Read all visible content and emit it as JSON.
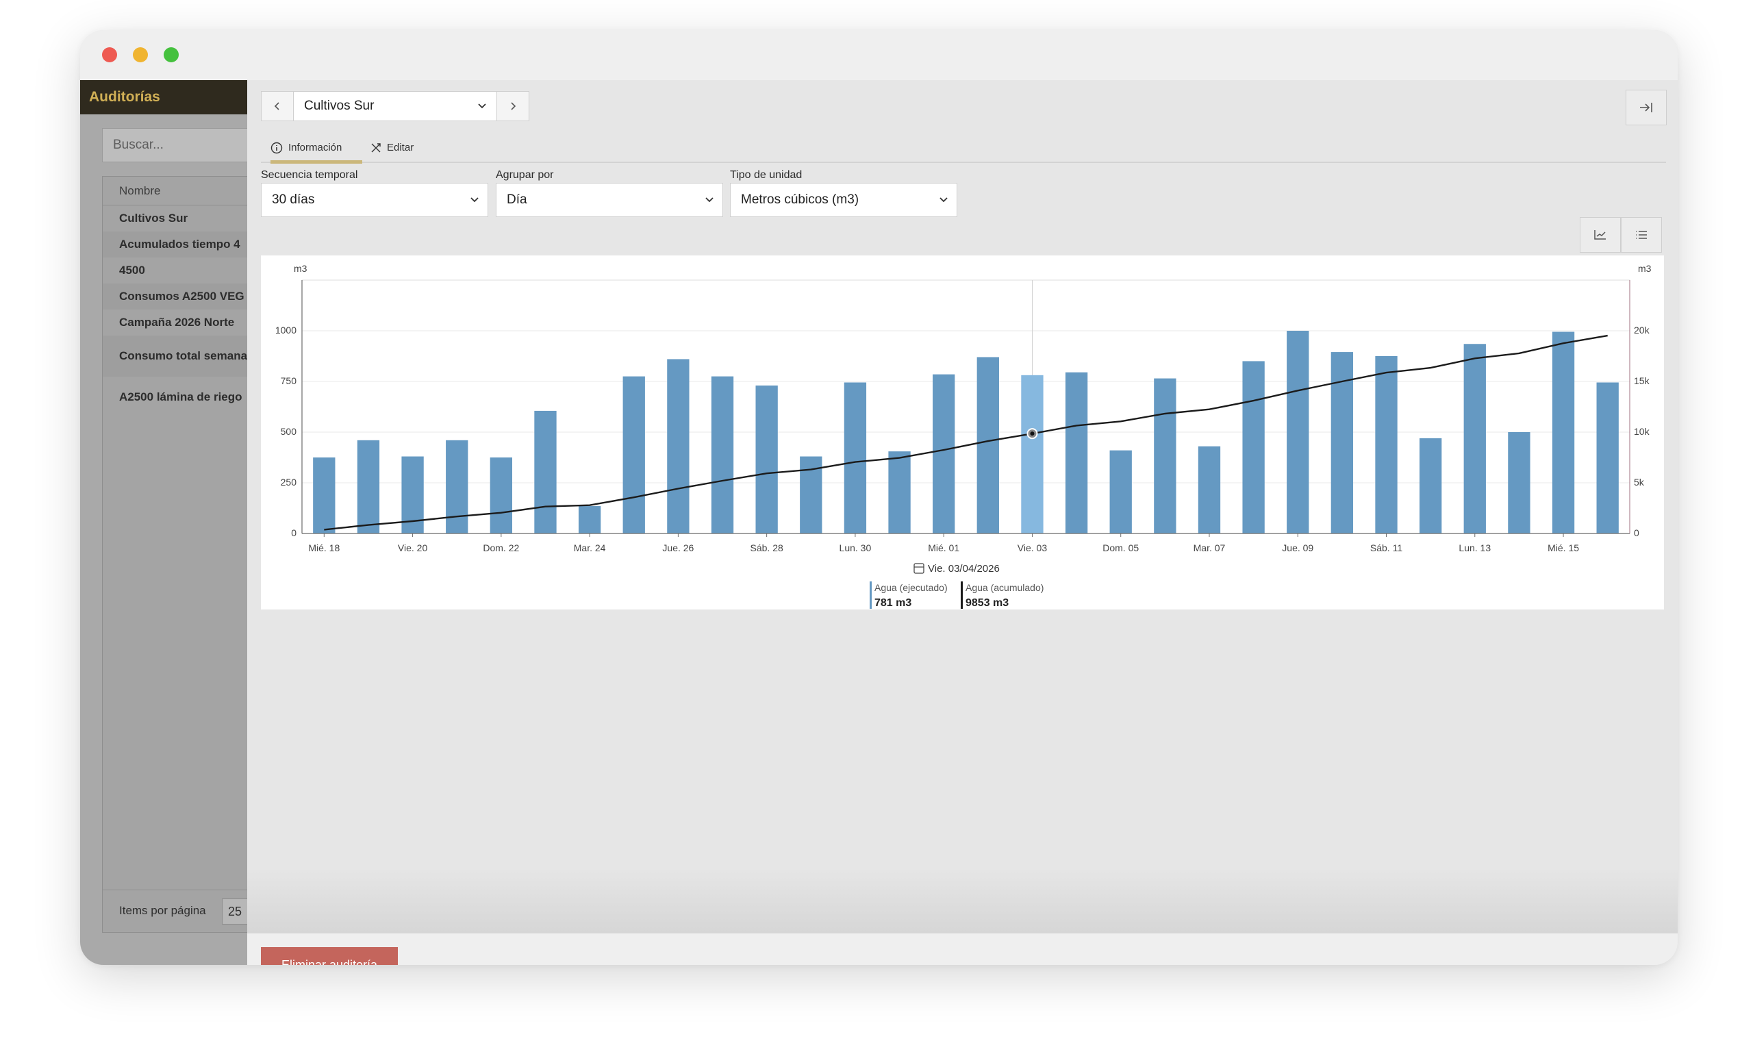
{
  "sidebar": {
    "title": "Auditorías",
    "search_placeholder": "Buscar...",
    "column_header": "Nombre",
    "items": [
      "Cultivos Sur",
      "Acumulados tiempo 4",
      "4500",
      "Consumos A2500 VEG",
      "Campaña 2026 Norte",
      "Consumo total semana",
      "A2500 lámina de riego"
    ],
    "items_per_page_label": "Items por página",
    "items_per_page_value": "25"
  },
  "header": {
    "selected_audit": "Cultivos Sur",
    "prev_icon": "chevron-left-icon",
    "next_icon": "chevron-right-icon",
    "close_icon": "collapse-right-icon"
  },
  "tabs": [
    {
      "label": "Información",
      "icon": "info-icon",
      "active": true
    },
    {
      "label": "Editar",
      "icon": "tools-icon",
      "active": false
    }
  ],
  "filters": {
    "time_sequence": {
      "label": "Secuencia temporal",
      "value": "30 días"
    },
    "group_by": {
      "label": "Agrupar por",
      "value": "Día"
    },
    "unit_type": {
      "label": "Tipo de unidad",
      "value": "Metros cúbicos (m3)"
    }
  },
  "view_buttons": [
    "line-chart-icon",
    "list-icon"
  ],
  "chart_data": {
    "type": "bar",
    "left_axis_unit": "m3",
    "right_axis_unit": "m3",
    "left_ylim": [
      0,
      1000
    ],
    "left_ticks": [
      "0",
      "250",
      "500",
      "750",
      "1000"
    ],
    "right_ylim": [
      0,
      20000
    ],
    "right_ticks": [
      "0",
      "5k",
      "10k",
      "15k",
      "20k"
    ],
    "x_tick_labels": [
      "Mié. 18",
      "Vie. 20",
      "Dom. 22",
      "Mar. 24",
      "Jue. 26",
      "Sáb. 28",
      "Lun. 30",
      "Mié. 01",
      "Vie. 03",
      "Dom. 05",
      "Mar. 07",
      "Jue. 09",
      "Sáb. 11",
      "Lun. 13",
      "Mié. 15"
    ],
    "series": [
      {
        "name": "Agua (ejecutado)",
        "kind": "bar",
        "axis": "left",
        "color": "#6599c2",
        "values": [
          375,
          460,
          380,
          460,
          375,
          605,
          135,
          775,
          860,
          775,
          730,
          380,
          745,
          405,
          785,
          870,
          781,
          795,
          410,
          765,
          430,
          850,
          1000,
          895,
          875,
          470,
          935,
          500,
          995,
          745
        ]
      },
      {
        "name": "Agua (acumulado)",
        "kind": "line",
        "axis": "right",
        "color": "#1b1b1b",
        "values": [
          375,
          835,
          1215,
          1675,
          2050,
          2655,
          2790,
          3565,
          4425,
          5200,
          5930,
          6310,
          7055,
          7460,
          8245,
          9115,
          9853,
          10648,
          11058,
          11823,
          12253,
          13103,
          14103,
          14998,
          15873,
          16343,
          17278,
          17778,
          18773,
          19518
        ]
      }
    ],
    "highlight_index": 16,
    "highlight_color": "#86b8df",
    "tooltip": {
      "date": "Vie. 03/04/2026",
      "items": [
        {
          "label": "Agua (ejecutado)",
          "value": "781 m3",
          "color": "#6599c2"
        },
        {
          "label": "Agua (acumulado)",
          "value": "9853 m3",
          "color": "#1b1b1b"
        }
      ]
    }
  },
  "actions": {
    "delete_label": "Eliminar auditoría"
  }
}
